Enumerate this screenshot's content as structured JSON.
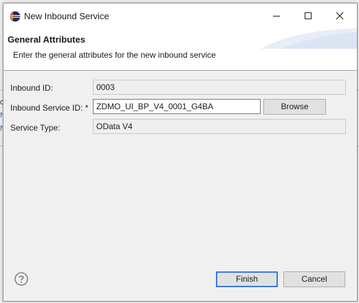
{
  "window": {
    "title": "New Inbound Service"
  },
  "banner": {
    "title": "General Attributes",
    "description": "Enter the general attributes for the new inbound service"
  },
  "fields": {
    "inbound_id": {
      "label": "Inbound ID:",
      "value": "0003"
    },
    "inbound_service_id": {
      "label": "Inbound Service ID: *",
      "value": "ZDMO_UI_BP_V4_0001_G4BA"
    },
    "service_type": {
      "label": "Service Type:",
      "value": "OData V4"
    }
  },
  "buttons": {
    "browse": "Browse",
    "finish": "Finish",
    "cancel": "Cancel"
  },
  "icons": {
    "app": "eclipse-icon",
    "minimize": "minimize-icon",
    "maximize": "maximize-icon",
    "close": "close-icon",
    "help": "help-icon"
  },
  "colors": {
    "default_button_border": "#3c78d8",
    "dialog_background": "#f0f0f0"
  }
}
